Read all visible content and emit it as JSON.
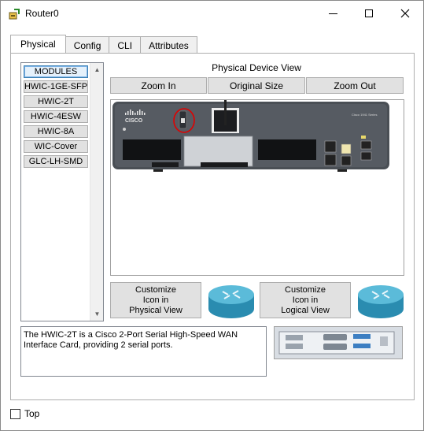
{
  "window": {
    "title": "Router0",
    "icon": "router-app-icon",
    "controls": {
      "minimize": "minimize-icon",
      "maximize": "maximize-icon",
      "close": "close-icon"
    }
  },
  "tabs": [
    "Physical",
    "Config",
    "CLI",
    "Attributes"
  ],
  "active_tab": "Physical",
  "modules": {
    "items": [
      "MODULES",
      "HWIC-1GE-SFP",
      "HWIC-2T",
      "HWIC-4ESW",
      "HWIC-8A",
      "WIC-Cover",
      "GLC-LH-SMD"
    ],
    "selected": "MODULES"
  },
  "physical_view": {
    "label": "Physical Device View",
    "zoom_in": "Zoom In",
    "original_size": "Original Size",
    "zoom_out": "Zoom Out",
    "device": {
      "brand": "CISCO",
      "model_label": "Cisco 1941 Series",
      "power_switch_annotation_color": "#e00000"
    }
  },
  "customize": {
    "physical": [
      "Customize",
      "Icon in",
      "Physical View"
    ],
    "logical": [
      "Customize",
      "Icon in",
      "Logical View"
    ]
  },
  "description": "The HWIC-2T is a Cisco 2-Port Serial High-Speed WAN Interface Card, providing 2 serial ports.",
  "footer": {
    "top_label": "Top",
    "top_checked": false
  },
  "colors": {
    "accent": "#3c7fb1",
    "chassis": "#4a4f55",
    "router_blue": "#3aa6c9"
  }
}
